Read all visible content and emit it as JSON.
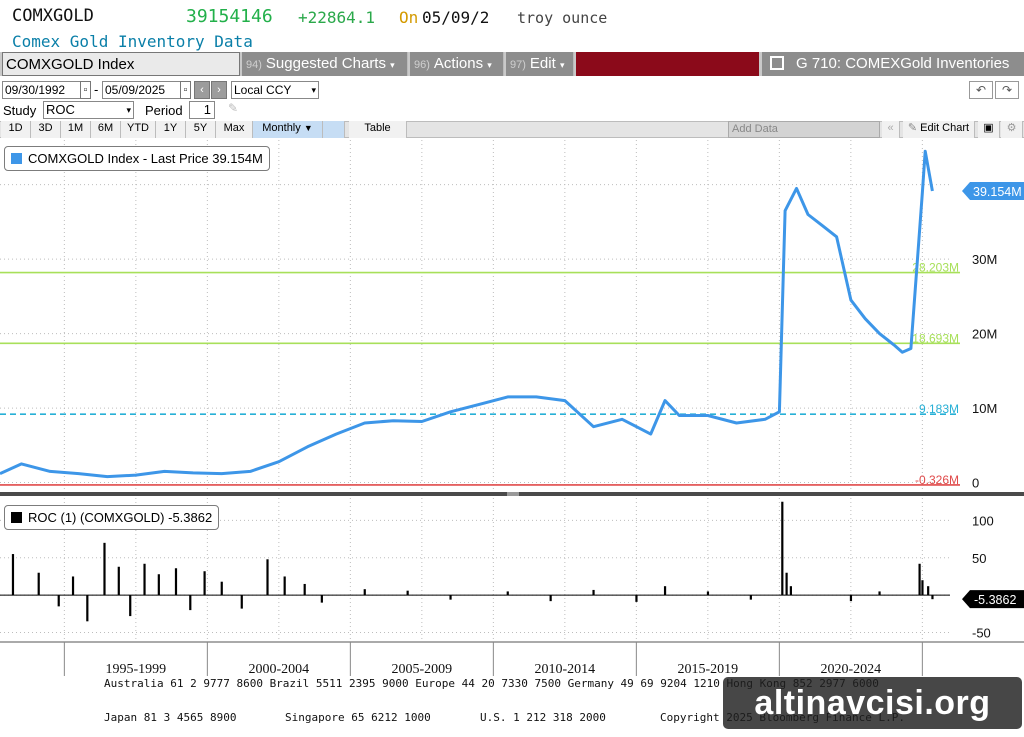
{
  "header": {
    "ticker": "COMXGOLD",
    "price": "39154146",
    "change": "+22864.1",
    "on_label": "On",
    "date": "05/09/2",
    "unit": "troy ounce",
    "subtitle": "Comex Gold Inventory Data"
  },
  "toolbar": {
    "security": "COMXGOLD Index",
    "suggested_num": "94)",
    "suggested_label": "Suggested Charts",
    "actions_num": "96)",
    "actions_label": "Actions",
    "edit_num": "97)",
    "edit_label": "Edit",
    "function_title": "G 710: COMEXGold Inventories",
    "start_date": "09/30/1992",
    "end_date": "05/09/2025",
    "currency": "Local CCY",
    "study_label": "Study",
    "study_value": "ROC",
    "period_label": "Period",
    "period_value": "1",
    "periods": [
      "1D",
      "3D",
      "1M",
      "6M",
      "YTD",
      "1Y",
      "5Y",
      "Max"
    ],
    "frequency": "Monthly",
    "table_label": "Table",
    "add_data": "Add Data",
    "edit_chart": "Edit Chart"
  },
  "colors": {
    "price_line": "#3d96e8",
    "green_level": "#a8e05a",
    "blue_level": "#27b0d6",
    "red_level": "#e04a4a",
    "toolbar_dark": "#8d8d8d",
    "toolbar_red": "#8b0a1a"
  },
  "chart_data": [
    {
      "type": "line",
      "legend": "COMXGOLD Index - Last Price 39.154M",
      "last_value_label": "39.154M",
      "ylim": [
        -1,
        46
      ],
      "y_unit": "M",
      "y_ticks": [
        "0",
        "10M",
        "20M",
        "30M"
      ],
      "x_tick_labels": [
        "1995-1999",
        "2000-2004",
        "2005-2009",
        "2010-2014",
        "2015-2019",
        "2020-2024"
      ],
      "levels": [
        {
          "label": "28.203M",
          "value": 28.203,
          "color": "green"
        },
        {
          "label": "18.693M",
          "value": 18.693,
          "color": "green"
        },
        {
          "label": "9.183M",
          "value": 9.183,
          "color": "blue"
        },
        {
          "label": "-0.326M",
          "value": -0.326,
          "color": "red"
        }
      ],
      "x": [
        1992.75,
        1993.5,
        1994.5,
        1995.5,
        1996.5,
        1997.5,
        1998.5,
        1999.5,
        2000.5,
        2001.5,
        2002.5,
        2003.5,
        2004.5,
        2005.5,
        2006.5,
        2007.5,
        2008.5,
        2009.5,
        2010.5,
        2011.5,
        2012.5,
        2013.5,
        2014.5,
        2015.5,
        2016.0,
        2016.5,
        2017.5,
        2018.5,
        2019.5,
        2020.0,
        2020.2,
        2020.6,
        2021.0,
        2021.5,
        2022.0,
        2022.5,
        2023.0,
        2023.5,
        2024.0,
        2024.3,
        2024.6,
        2025.0,
        2025.1,
        2025.35
      ],
      "y": [
        1.2,
        2.5,
        1.5,
        1.2,
        0.8,
        1.0,
        1.5,
        1.3,
        1.2,
        1.5,
        2.8,
        4.8,
        6.5,
        8.0,
        8.3,
        8.2,
        9.5,
        10.5,
        11.5,
        11.5,
        11.0,
        7.5,
        8.5,
        6.5,
        11.0,
        9.0,
        9.0,
        8.0,
        8.5,
        9.5,
        36.5,
        39.5,
        36.0,
        34.5,
        33.0,
        24.5,
        22.0,
        20.0,
        18.5,
        17.5,
        18.0,
        39.0,
        44.5,
        39.154
      ]
    },
    {
      "type": "bar",
      "legend": "ROC (1) (COMXGOLD) -5.3862",
      "last_value_label": "-5.3862",
      "ylim": [
        -60,
        130
      ],
      "y_ticks": [
        "100",
        "50",
        "0",
        "-50"
      ],
      "x": [
        1993.2,
        1994.1,
        1994.8,
        1995.3,
        1995.8,
        1996.4,
        1996.9,
        1997.3,
        1997.8,
        1998.3,
        1998.9,
        1999.4,
        1999.9,
        2000.5,
        2001.2,
        2002.1,
        2002.7,
        2003.4,
        2004.0,
        2005.5,
        2007.0,
        2008.5,
        2010.5,
        2012.0,
        2013.5,
        2015.0,
        2016.0,
        2017.5,
        2019.0,
        2020.1,
        2020.25,
        2020.4,
        2022.5,
        2023.5,
        2024.9,
        2025.0,
        2025.2,
        2025.35
      ],
      "values": [
        55,
        30,
        -15,
        25,
        -35,
        70,
        38,
        -28,
        42,
        28,
        36,
        -20,
        32,
        18,
        -18,
        48,
        25,
        15,
        -10,
        8,
        6,
        -6,
        5,
        -8,
        7,
        -9,
        12,
        5,
        -6,
        125,
        30,
        12,
        -8,
        5,
        42,
        20,
        12,
        -5.3862
      ]
    }
  ],
  "footer": {
    "line1": "Australia 61 2 9777 8600 Brazil 5511 2395 9000 Europe 44 20 7330 7500 Germany 49 69 9204 1210 Hong Kong 852 2977 6000",
    "line2_a": "Japan 81 3 4565 8900",
    "line2_b": "Singapore 65 6212 1000",
    "line2_c": "U.S. 1 212 318 2000",
    "line2_d": "Copyright 2025 Bloomberg Finance L.P.",
    "watermark": "altinavcisi.org"
  }
}
